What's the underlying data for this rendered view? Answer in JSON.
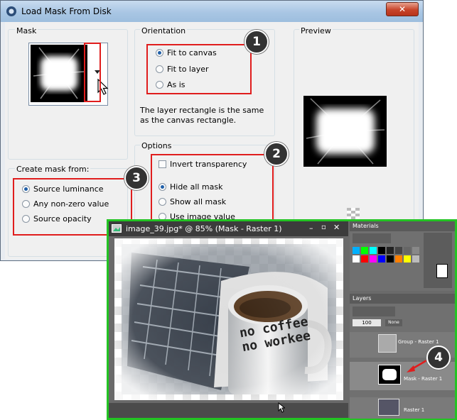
{
  "dialog": {
    "title": "Load Mask From Disk",
    "close_glyph": "✕",
    "mask_group_label": "Mask",
    "orientation": {
      "label": "Orientation",
      "options": [
        "Fit to canvas",
        "Fit to layer",
        "As is"
      ],
      "selected": 0,
      "description": "The layer rectangle is the same as the canvas rectangle."
    },
    "preview_label": "Preview",
    "create_mask": {
      "label": "Create mask from:",
      "options": [
        "Source luminance",
        "Any non-zero value",
        "Source opacity"
      ],
      "selected": 0
    },
    "options": {
      "label": "Options",
      "invert_label": "Invert transparency",
      "invert_checked": false,
      "mask_options": [
        "Hide all mask",
        "Show all mask",
        "Use image value"
      ],
      "selected": 0
    }
  },
  "badges": [
    "1",
    "2",
    "3",
    "4"
  ],
  "editor": {
    "doc_title": "image_39.jpg* @  85% (Mask - Raster 1)",
    "mug_text_line1": "no coffee",
    "mug_text_line2": "no workee",
    "materials_label": "Materials",
    "layers_label": "Layers",
    "opacity_value": "100",
    "blend_mode": "None",
    "layer_group": "Group - Raster 1",
    "layer_mask": "Mask - Raster 1",
    "layer_raster": "Raster 1"
  },
  "colors": {
    "highlight_red": "#e01d1d",
    "highlight_green": "#23c423",
    "radio_dot": "#1f5fa8"
  }
}
